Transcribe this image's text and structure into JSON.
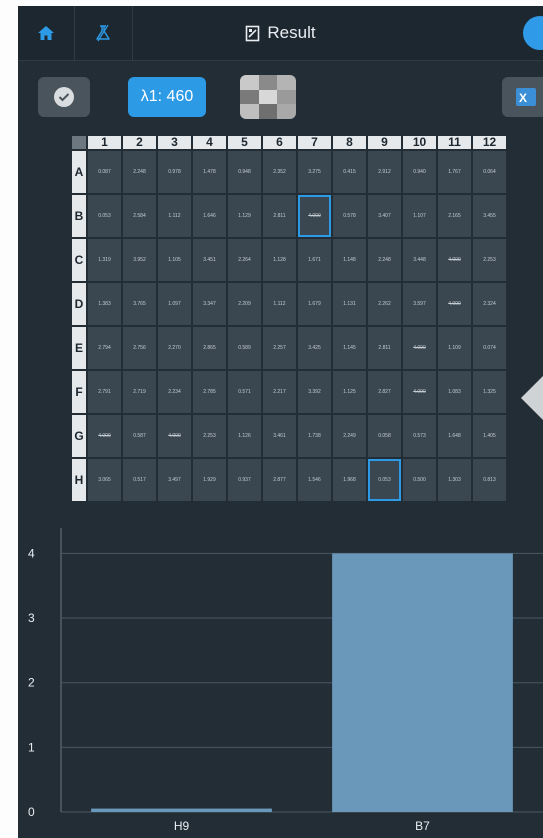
{
  "header": {
    "title": "Result"
  },
  "toolbar": {
    "wavelength_label": "λ1: 460"
  },
  "plate": {
    "columns": [
      "1",
      "2",
      "3",
      "4",
      "5",
      "6",
      "7",
      "8",
      "9",
      "10",
      "11",
      "12"
    ],
    "rows": [
      {
        "label": "A",
        "values": [
          "0.087",
          "2.248",
          "0.978",
          "1.478",
          "0.948",
          "2.352",
          "3.275",
          "0.415",
          "2.912",
          "0.940",
          "1.767",
          "0.064"
        ]
      },
      {
        "label": "B",
        "values": [
          "0.053",
          "2.584",
          "1.112",
          "1.646",
          "1.129",
          "2.811",
          "4.000",
          "0.578",
          "3.407",
          "1.107",
          "2.165",
          "3.455"
        ]
      },
      {
        "label": "C",
        "values": [
          "1.319",
          "3.952",
          "1.105",
          "3.451",
          "2.264",
          "1.128",
          "1.671",
          "1.148",
          "2.248",
          "3.448",
          "4.000",
          "2.253"
        ]
      },
      {
        "label": "D",
        "values": [
          "1.383",
          "3.765",
          "1.097",
          "3.347",
          "2.209",
          "1.112",
          "1.679",
          "1.131",
          "2.262",
          "3.597",
          "4.000",
          "2.324"
        ]
      },
      {
        "label": "E",
        "values": [
          "2.794",
          "2.756",
          "2.270",
          "2.865",
          "0.589",
          "2.257",
          "3.425",
          "1.145",
          "2.811",
          "4.000",
          "1.109",
          "0.074"
        ]
      },
      {
        "label": "F",
        "values": [
          "2.791",
          "2.719",
          "2.234",
          "2.785",
          "0.571",
          "2.217",
          "3.392",
          "1.125",
          "2.827",
          "4.000",
          "1.083",
          "1.325"
        ]
      },
      {
        "label": "G",
        "values": [
          "4.000",
          "0.587",
          "4.000",
          "2.253",
          "1.126",
          "3.461",
          "1.738",
          "2.249",
          "0.058",
          "0.573",
          "1.648",
          "1.405"
        ]
      },
      {
        "label": "H",
        "values": [
          "3.065",
          "0.517",
          "3.497",
          "1.929",
          "0.937",
          "2.877",
          "1.546",
          "1.968",
          "0.053",
          "0.500",
          "1.303",
          "0.813"
        ]
      }
    ],
    "selected_wells": [
      "B7",
      "H9"
    ],
    "flag_value": "4.000"
  },
  "chart_data": {
    "type": "bar",
    "categories": [
      "H9",
      "B7"
    ],
    "values": [
      0.053,
      4.0
    ],
    "ylim": [
      0,
      4.3
    ],
    "yticks": [
      0,
      1,
      2,
      3,
      4
    ],
    "grid": true,
    "bar_color": "#6a98ba",
    "xlabel": "",
    "ylabel": ""
  },
  "colors": {
    "accent": "#2d9ae6",
    "background": "#222d36",
    "cell": "#3a4650"
  }
}
